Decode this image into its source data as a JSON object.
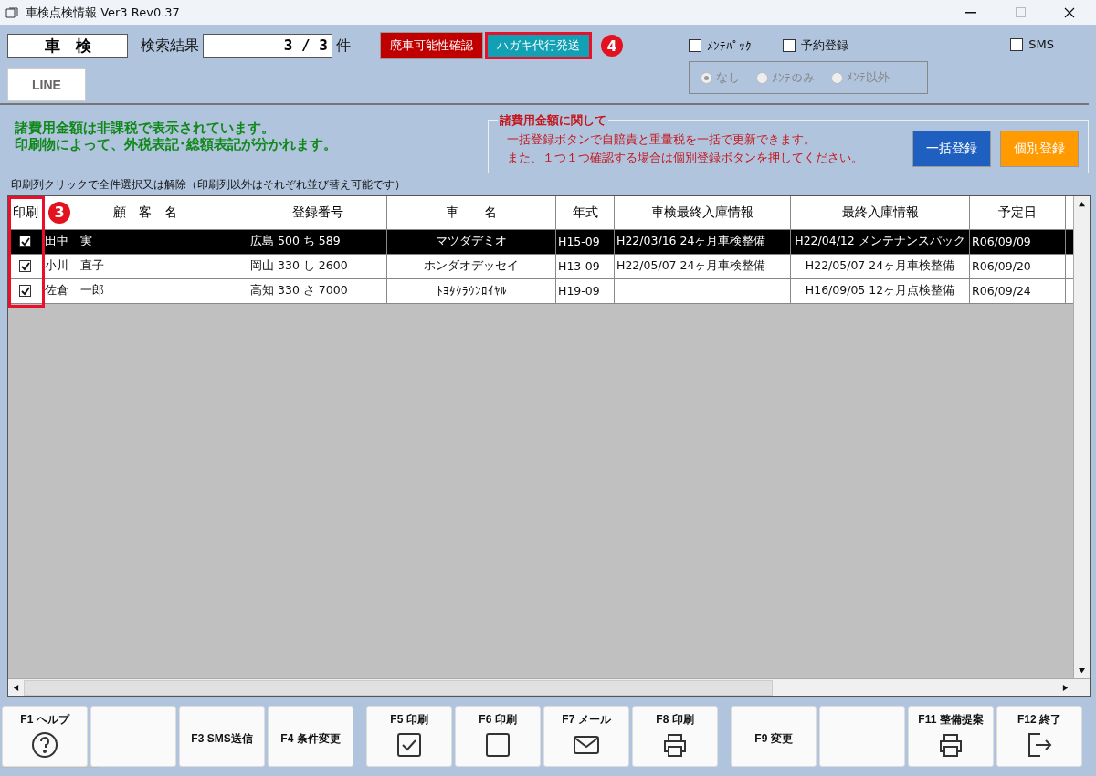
{
  "window": {
    "title": "車検点検情報 Ver3 Rev0.37"
  },
  "mode_label": "車　検",
  "search_result": {
    "label": "検索結果",
    "value": "3 / 3",
    "unit": "件"
  },
  "top_buttons": [
    {
      "label": "廃車可能性確認",
      "color": "#c00000",
      "highlighted": false
    },
    {
      "label": "ハガキ代行発送",
      "color": "#12a0b4",
      "highlighted": true,
      "badge": "4"
    }
  ],
  "line_button": "LINE",
  "options": [
    {
      "label": "ﾒﾝﾃﾊﾟｯｸ",
      "checked": false
    },
    {
      "label": "予約登録",
      "checked": false
    },
    {
      "label": "SMS",
      "checked": false
    }
  ],
  "radio_group": {
    "disabled": true,
    "items": [
      {
        "label": "なし",
        "selected": true
      },
      {
        "label": "ﾒﾝﾃのみ",
        "selected": false
      },
      {
        "label": "ﾒﾝﾃ以外",
        "selected": false
      }
    ]
  },
  "notice": [
    "諸費用金額は非課税で表示されています。",
    "印刷物によって、外税表記･総額表記が分かれます。"
  ],
  "fee_box": {
    "title": "諸費用金額に関して",
    "lines": [
      "一括登録ボタンで自賠責と重量税を一括で更新できます。",
      "また、１つ１つ確認する場合は個別登録ボタンを押してください。"
    ],
    "buttons": [
      {
        "label": "一括登録",
        "color": "#1f5fbf"
      },
      {
        "label": "個別登録",
        "color": "#ff9a00"
      }
    ]
  },
  "hint": "印刷列クリックで全件選択又は解除（印刷列以外はそれぞれ並び替え可能です）",
  "table": {
    "print_column_highlighted": true,
    "badge": "3",
    "print_header": "印刷",
    "columns": [
      "顧　客　名",
      "登録番号",
      "車　　名",
      "年式",
      "車検最終入庫情報",
      "最終入庫情報",
      "予定日"
    ],
    "rows": [
      {
        "selected": true,
        "checked": true,
        "cells": [
          "田中　実",
          "広島 500 ち 589",
          "マツダデミオ",
          "H15-09",
          "H22/03/16 24ヶ月車検整備",
          "H22/04/12 メンテナンスパック",
          "R06/09/09"
        ]
      },
      {
        "selected": false,
        "checked": true,
        "cells": [
          "小川　直子",
          "岡山 330 し 2600",
          "ホンダオデッセイ",
          "H13-09",
          "H22/05/07 24ヶ月車検整備",
          "H22/05/07 24ヶ月車検整備",
          "R06/09/20"
        ]
      },
      {
        "selected": false,
        "checked": true,
        "cells": [
          "佐倉　一郎",
          "高知 330 さ 7000",
          "ﾄﾖﾀｸﾗｳﾝﾛｲﾔﾙ",
          "H19-09",
          "",
          "H16/09/05 12ヶ月点検整備",
          "R06/09/24"
        ]
      }
    ]
  },
  "function_keys": [
    {
      "label": "F1 ヘルプ",
      "kind": "help"
    },
    {
      "kind": "blank"
    },
    {
      "label": "F3 SMS送信",
      "kind": "text"
    },
    {
      "label": "F4 条件変更",
      "kind": "text"
    },
    {
      "label": "F5 印刷",
      "kind": "check"
    },
    {
      "label": "F6 印刷",
      "kind": "square"
    },
    {
      "label": "F7 メール",
      "kind": "mail"
    },
    {
      "label": "F8 印刷",
      "kind": "printer"
    },
    {
      "label": "F9 変更",
      "kind": "text"
    },
    {
      "kind": "blank"
    },
    {
      "label": "F11 整備提案",
      "kind": "printer"
    },
    {
      "label": "F12 終了",
      "kind": "exit"
    }
  ]
}
